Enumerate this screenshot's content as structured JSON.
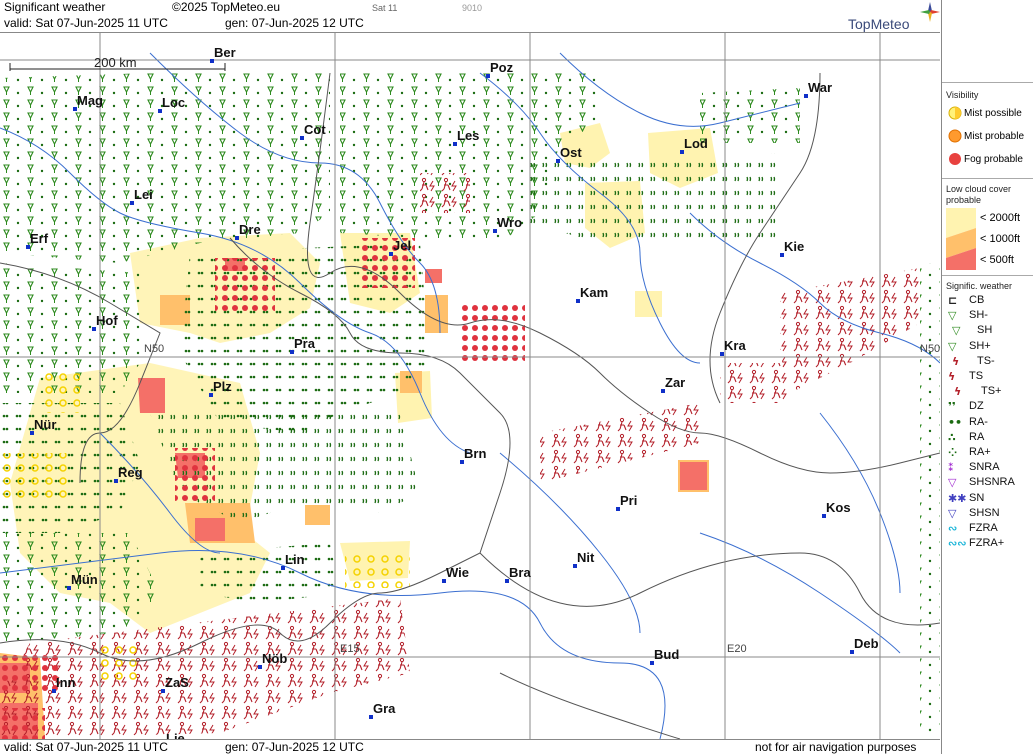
{
  "header": {
    "title": "Significant weather",
    "copyright": "©2025 TopMeteo.eu",
    "sat_tag": "Sat 11",
    "code": "9010",
    "valid": "valid:  Sat  07-Jun-2025  11 UTC",
    "gen": "gen: 07-Jun-2025 12 UTC",
    "logo": "TopMeteo"
  },
  "footer": {
    "valid": "valid:  Sat   07-Jun-2025   11 UTC",
    "gen": "gen: 07-Jun-2025 12 UTC",
    "disclaimer": "not for air navigation purposes"
  },
  "map": {
    "scale_label": "200 km",
    "grid_labels": [
      "N50",
      "N50",
      "E15",
      "E20"
    ],
    "cities": [
      "Ber",
      "Poz",
      "War",
      "Mag",
      "Loc",
      "Cot",
      "Les",
      "Ost",
      "Lod",
      "Lei",
      "Wro",
      "Erf",
      "Dre",
      "Jel",
      "Kie",
      "Kam",
      "Hof",
      "Pra",
      "Kra",
      "Plz",
      "Zar",
      "Nür",
      "Brn",
      "Reg",
      "Pri",
      "Kos",
      "Lin",
      "Nit",
      "Wie",
      "Bra",
      "Mün",
      "Deb",
      "Bud",
      "Nöb",
      "Inn",
      "ZaS",
      "Lie",
      "Gra"
    ]
  },
  "legend": {
    "visibility_title": "Visibility",
    "visibility_items": [
      "Mist possible",
      "Mist probable",
      "Fog probable"
    ],
    "cloud_title": "Low cloud cover probable",
    "cloud_items": [
      "< 2000ft",
      "< 1000ft",
      "<   500ft"
    ],
    "weather_title": "Signific. weather",
    "weather_items": [
      "CB",
      "SH-",
      "SH",
      "SH+",
      "TS-",
      "TS",
      "TS+",
      "DZ",
      "RA-",
      "RA",
      "RA+",
      "SNRA",
      "SHSNRA",
      "SN",
      "SHSN",
      "FZRA",
      "FZRA+"
    ],
    "colors": {
      "mist_possible": "#fff27a",
      "mist_probable": "#ff9a2e",
      "fog_probable": "#e8413f",
      "cloud_2000": "#fff3b0",
      "cloud_1000": "#ffc06b",
      "cloud_500": "#f47068",
      "shower": "#2d8a1e",
      "thunder": "#b3202a",
      "rain": "#1b6b12",
      "snow": "#a02ad0",
      "freezing": "#18b4d8"
    }
  }
}
